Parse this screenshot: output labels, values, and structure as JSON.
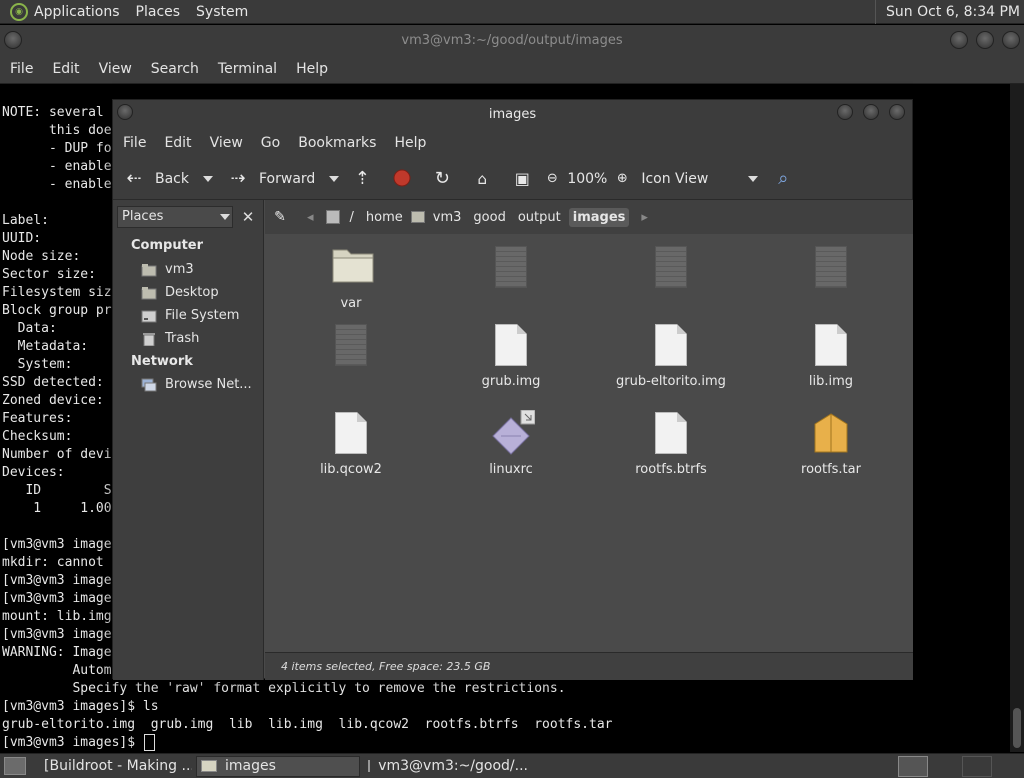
{
  "top_panel": {
    "menus": [
      "Applications",
      "Places",
      "System"
    ],
    "clock": "Sun Oct  6,  8:34 PM"
  },
  "terminal": {
    "title": "vm3@vm3:~/good/output/images",
    "menus": [
      "File",
      "Edit",
      "View",
      "Search",
      "Terminal",
      "Help"
    ],
    "lines": [
      "NOTE: several",
      "      this doe",
      "      - DUP fo",
      "      - enable",
      "      - enable",
      "",
      "Label:",
      "UUID:",
      "Node size:",
      "Sector size:",
      "Filesystem siz",
      "Block group pr",
      "  Data:",
      "  Metadata:",
      "  System:",
      "SSD detected:",
      "Zoned device:",
      "Features:",
      "Checksum:",
      "Number of devi",
      "Devices:",
      "   ID        S",
      "    1     1.00",
      "",
      "[vm3@vm3 image",
      "mkdir: cannot",
      "[vm3@vm3 image",
      "[vm3@vm3 image",
      "mount: lib.img",
      "[vm3@vm3 image",
      "WARNING: Image",
      "         Autom                                                                                    icted.",
      "         Specify the 'raw' format explicitly to remove the restrictions.",
      "[vm3@vm3 images]$ ls",
      "grub-eltorito.img  grub.img  lib  lib.img  lib.qcow2  rootfs.btrfs  rootfs.tar",
      "[vm3@vm3 images]$ "
    ]
  },
  "file_manager": {
    "title": "images",
    "menus": [
      "File",
      "Edit",
      "View",
      "Go",
      "Bookmarks",
      "Help"
    ],
    "toolbar": {
      "back": "Back",
      "forward": "Forward",
      "zoom": "100%",
      "view_mode": "Icon View"
    },
    "sidebar": {
      "selector": "Places",
      "computer_heading": "Computer",
      "computer_items": [
        "vm3",
        "Desktop",
        "File System",
        "Trash"
      ],
      "network_heading": "Network",
      "network_items": [
        "Browse Net..."
      ]
    },
    "breadcrumbs": [
      "/",
      "home",
      "vm3",
      "good",
      "output",
      "images"
    ],
    "files": [
      {
        "name": "var",
        "kind": "folder"
      },
      {
        "name": "",
        "kind": "grey-doc"
      },
      {
        "name": "",
        "kind": "grey-doc"
      },
      {
        "name": "",
        "kind": "grey-doc"
      },
      {
        "name": "",
        "kind": "grey-doc"
      },
      {
        "name": "grub.img",
        "kind": "doc"
      },
      {
        "name": "grub-eltorito.img",
        "kind": "doc"
      },
      {
        "name": "lib.img",
        "kind": "doc"
      },
      {
        "name": "lib.qcow2",
        "kind": "doc"
      },
      {
        "name": "linuxrc",
        "kind": "link"
      },
      {
        "name": "rootfs.btrfs",
        "kind": "doc"
      },
      {
        "name": "rootfs.tar",
        "kind": "archive"
      }
    ],
    "status": "4 items selected, Free space: 23.5 GB"
  },
  "taskbar": {
    "tasks": [
      "[Buildroot - Making ...",
      "images",
      "vm3@vm3:~/good/..."
    ]
  },
  "colors": {
    "folder": "#d6d4c2",
    "archive": "#e8b04a",
    "stop": "#c0392b"
  }
}
